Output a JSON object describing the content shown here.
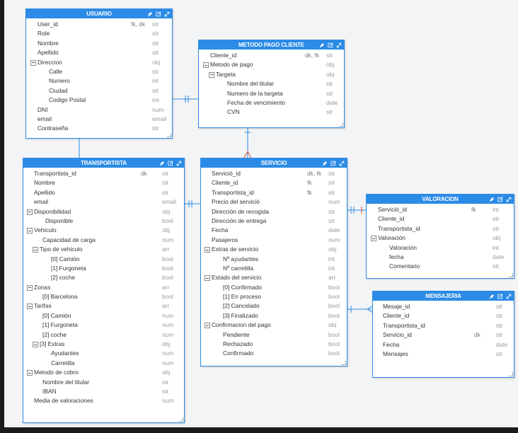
{
  "colors": {
    "entity_header": "#2b8be6",
    "entity_border": "#2b8be6",
    "connector": "#2b8be6",
    "relation_marker": "#e64a2e",
    "canvas": "#f3f4f6"
  },
  "icons": [
    "pin-icon",
    "edit-icon",
    "expand-icon"
  ],
  "entities": [
    {
      "id": "usuario",
      "title": "USUARIO",
      "fields": [
        {
          "name": "User_id",
          "key": "fk, dk",
          "type": "str",
          "depth": 0
        },
        {
          "name": "Role",
          "key": "",
          "type": "str",
          "depth": 0
        },
        {
          "name": "Nombre",
          "key": "",
          "type": "str",
          "depth": 0
        },
        {
          "name": "Apellido",
          "key": "",
          "type": "str",
          "depth": 0
        },
        {
          "name": "Direccion",
          "key": "",
          "type": "obj",
          "depth": 0,
          "toggle": true
        },
        {
          "name": "Calle",
          "key": "",
          "type": "str",
          "depth": 2
        },
        {
          "name": "Numero",
          "key": "",
          "type": "int",
          "depth": 2
        },
        {
          "name": "Ciudad",
          "key": "",
          "type": "str",
          "depth": 2
        },
        {
          "name": "Codigo Postal",
          "key": "",
          "type": "inc",
          "depth": 2
        },
        {
          "name": "DNI",
          "key": "",
          "type": "num",
          "depth": 0
        },
        {
          "name": "email",
          "key": "",
          "type": "email",
          "depth": 0
        },
        {
          "name": "Contraseña",
          "key": "",
          "type": "str",
          "depth": 0
        }
      ]
    },
    {
      "id": "metodo-pago-cliente",
      "title": "METODO PAGO CLIENTE",
      "fields": [
        {
          "name": "Cliente_id",
          "key": "dk, fk",
          "type": "str",
          "depth": 0
        },
        {
          "name": "Metodo de pago",
          "key": "",
          "type": "obj",
          "depth": 0,
          "toggle": true
        },
        {
          "name": "Targeta",
          "key": "",
          "type": "obj",
          "depth": 1,
          "toggle": true
        },
        {
          "name": "Nombre del titular",
          "key": "",
          "type": "str",
          "depth": 3
        },
        {
          "name": "Numero de la targeta",
          "key": "",
          "type": "str",
          "depth": 3
        },
        {
          "name": "Fecha de vencimiento",
          "key": "",
          "type": "date",
          "depth": 3
        },
        {
          "name": "CVN",
          "key": "",
          "type": "str",
          "depth": 3
        }
      ]
    },
    {
      "id": "transportista",
      "title": "TRANSPORTISTA",
      "fields": [
        {
          "name": "Transportista_id",
          "key": "dk",
          "type": "str",
          "depth": 0
        },
        {
          "name": "Nombre",
          "key": "",
          "type": "str",
          "depth": 0
        },
        {
          "name": "Apellido",
          "key": "",
          "type": "str",
          "depth": 0
        },
        {
          "name": "email",
          "key": "",
          "type": "email",
          "depth": 0
        },
        {
          "name": "Disponibilidad",
          "key": "",
          "type": "obj",
          "depth": 0,
          "toggle": true
        },
        {
          "name": "Disponible",
          "key": "",
          "type": "bool",
          "depth": 2
        },
        {
          "name": "Vehiculo",
          "key": "",
          "type": "obj",
          "depth": 0,
          "toggle": true
        },
        {
          "name": "Capacidad de carga",
          "key": "",
          "type": "num",
          "depth": 1.5
        },
        {
          "name": "Tipo de vehiculo",
          "key": "",
          "type": "arr",
          "depth": 1,
          "toggle": true
        },
        {
          "name": "[0] Camión",
          "key": "",
          "type": "bool",
          "depth": 3
        },
        {
          "name": "[1] Furgoneta",
          "key": "",
          "type": "bool",
          "depth": 3
        },
        {
          "name": "[2] coche",
          "key": "",
          "type": "bool",
          "depth": 3
        },
        {
          "name": "Zonas",
          "key": "",
          "type": "arr",
          "depth": 0,
          "toggle": true
        },
        {
          "name": "[0] Barcelona",
          "key": "",
          "type": "bool",
          "depth": 1.5
        },
        {
          "name": "Tarifas",
          "key": "",
          "type": "arr",
          "depth": 0,
          "toggle": true
        },
        {
          "name": "[0] Camión",
          "key": "",
          "type": "num",
          "depth": 1.5
        },
        {
          "name": "[1] Furgoneta",
          "key": "",
          "type": "num",
          "depth": 1.5
        },
        {
          "name": "[2] coche",
          "key": "",
          "type": "num",
          "depth": 1.5
        },
        {
          "name": "[3] Extras",
          "key": "",
          "type": "obj",
          "depth": 1,
          "toggle": true
        },
        {
          "name": "Ayudantes",
          "key": "",
          "type": "num",
          "depth": 3
        },
        {
          "name": "Carretilla",
          "key": "",
          "type": "num",
          "depth": 3
        },
        {
          "name": "Metodo de cobro",
          "key": "",
          "type": "obj",
          "depth": 0,
          "toggle": true
        },
        {
          "name": "Nombre del titular",
          "key": "",
          "type": "str",
          "depth": 1.5
        },
        {
          "name": "IBAN",
          "key": "",
          "type": "str",
          "depth": 1.5
        },
        {
          "name": "Media de valoraciones",
          "key": "",
          "type": "num",
          "depth": 0
        }
      ]
    },
    {
      "id": "servicio",
      "title": "SERVICIO",
      "fields": [
        {
          "name": "Servició_id",
          "key": "dk, fk",
          "type": "str",
          "depth": 0
        },
        {
          "name": "Cliente_id",
          "key": "fk",
          "type": "str",
          "depth": 0
        },
        {
          "name": "Transportista_id",
          "key": "fk",
          "type": "str",
          "depth": 0
        },
        {
          "name": "Precio del servició",
          "key": "",
          "type": "num",
          "depth": 0
        },
        {
          "name": "Dirección de recogida",
          "key": "",
          "type": "str",
          "depth": 0
        },
        {
          "name": "Dirección de entrega",
          "key": "",
          "type": "str",
          "depth": 0
        },
        {
          "name": "Fecha",
          "key": "",
          "type": "date",
          "depth": 0
        },
        {
          "name": "Pasajeros",
          "key": "",
          "type": "num",
          "depth": 0
        },
        {
          "name": "Extras de servicio",
          "key": "",
          "type": "obj",
          "depth": 0,
          "toggle": true
        },
        {
          "name": "Nº ayudantes",
          "key": "",
          "type": "int",
          "depth": 2
        },
        {
          "name": "Nº carretilla",
          "key": "",
          "type": "int",
          "depth": 2
        },
        {
          "name": "Estado del servicio",
          "key": "",
          "type": "arr",
          "depth": 0,
          "toggle": true
        },
        {
          "name": "[0] Confirmado",
          "key": "",
          "type": "bool",
          "depth": 2
        },
        {
          "name": "[1] En proceso",
          "key": "",
          "type": "bool",
          "depth": 2
        },
        {
          "name": "[2] Cancelado",
          "key": "",
          "type": "bool",
          "depth": 2
        },
        {
          "name": "[3] Finalizado",
          "key": "",
          "type": "bool",
          "depth": 2
        },
        {
          "name": "Confirmacion del pago",
          "key": "",
          "type": "obj",
          "depth": 0,
          "toggle": true
        },
        {
          "name": "Pendiente",
          "key": "",
          "type": "bool",
          "depth": 2
        },
        {
          "name": "Rechazado",
          "key": "",
          "type": "bool",
          "depth": 2
        },
        {
          "name": "Confirmado",
          "key": "",
          "type": "bool",
          "depth": 2
        }
      ]
    },
    {
      "id": "valoracion",
      "title": "VALORACION",
      "fields": [
        {
          "name": "Servició_id",
          "key": "fk",
          "type": "int",
          "depth": 0
        },
        {
          "name": "Cliente_id",
          "key": "",
          "type": "str",
          "depth": 0
        },
        {
          "name": "Transportista_id",
          "key": "",
          "type": "str",
          "depth": 0
        },
        {
          "name": "Valoración",
          "key": "",
          "type": "obj",
          "depth": 0,
          "toggle": true
        },
        {
          "name": "Valoración",
          "key": "",
          "type": "int",
          "depth": 2
        },
        {
          "name": "fecha",
          "key": "",
          "type": "date",
          "depth": 2
        },
        {
          "name": "Comentario",
          "key": "",
          "type": "str",
          "depth": 2
        }
      ]
    },
    {
      "id": "mensajeria",
      "title": "MENSAJERIA",
      "fields": [
        {
          "name": "Mesaje_id",
          "key": "",
          "type": "str",
          "depth": 0
        },
        {
          "name": "Cliente_id",
          "key": "",
          "type": "str",
          "depth": 0
        },
        {
          "name": "Transportista_id",
          "key": "",
          "type": "str",
          "depth": 0
        },
        {
          "name": "Servicio_id",
          "key": "dk",
          "type": "str",
          "depth": 0
        },
        {
          "name": "Fecha",
          "key": "",
          "type": "date",
          "depth": 0
        },
        {
          "name": "Mensajes",
          "key": "",
          "type": "str",
          "depth": 0
        }
      ]
    }
  ]
}
